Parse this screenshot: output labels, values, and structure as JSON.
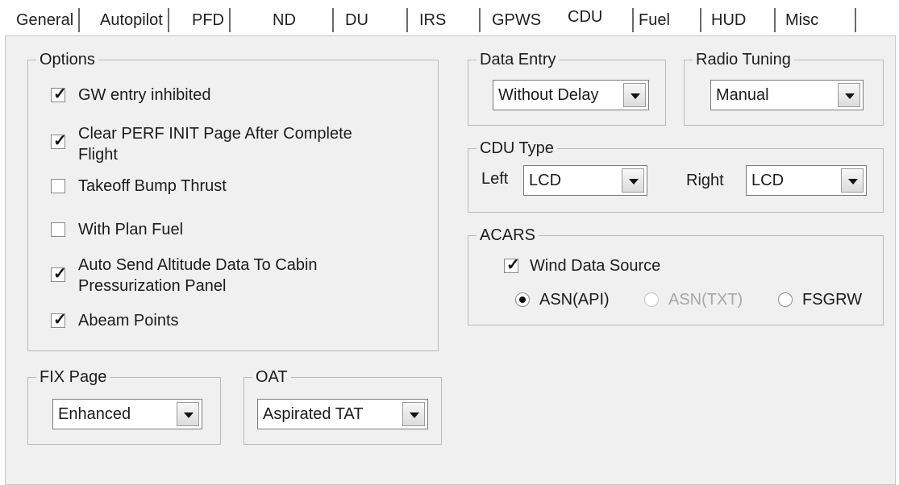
{
  "tabs": [
    "General",
    "Autopilot",
    "PFD",
    "ND",
    "DU",
    "IRS",
    "GPWS",
    "CDU",
    "Fuel",
    "HUD",
    "Misc"
  ],
  "active_tab": "CDU",
  "options": {
    "title": "Options",
    "items": [
      {
        "label": "GW entry inhibited",
        "checked": true
      },
      {
        "label": "Clear PERF INIT Page After Complete",
        "label2": "Flight",
        "checked": true
      },
      {
        "label": "Takeoff Bump Thrust",
        "checked": false
      },
      {
        "label": "With Plan Fuel",
        "checked": false
      },
      {
        "label": "Auto Send Altitude Data To Cabin",
        "label2": "Pressurization Panel",
        "checked": true
      },
      {
        "label": "Abeam Points",
        "checked": true
      }
    ]
  },
  "fix_page": {
    "title": "FIX Page",
    "value": "Enhanced"
  },
  "oat": {
    "title": "OAT",
    "value": "Aspirated TAT"
  },
  "data_entry": {
    "title": "Data Entry",
    "value": "Without Delay"
  },
  "radio_tuning": {
    "title": "Radio Tuning",
    "value": "Manual"
  },
  "cdu_type": {
    "title": "CDU Type",
    "left_label": "Left",
    "left_value": "LCD",
    "right_label": "Right",
    "right_value": "LCD"
  },
  "acars": {
    "title": "ACARS",
    "wind_label": "Wind Data Source",
    "wind_checked": true,
    "sources": [
      {
        "label": "ASN(API)",
        "selected": true,
        "enabled": true
      },
      {
        "label": "ASN(TXT)",
        "selected": false,
        "enabled": false
      },
      {
        "label": "FSGRW",
        "selected": false,
        "enabled": true
      }
    ]
  }
}
